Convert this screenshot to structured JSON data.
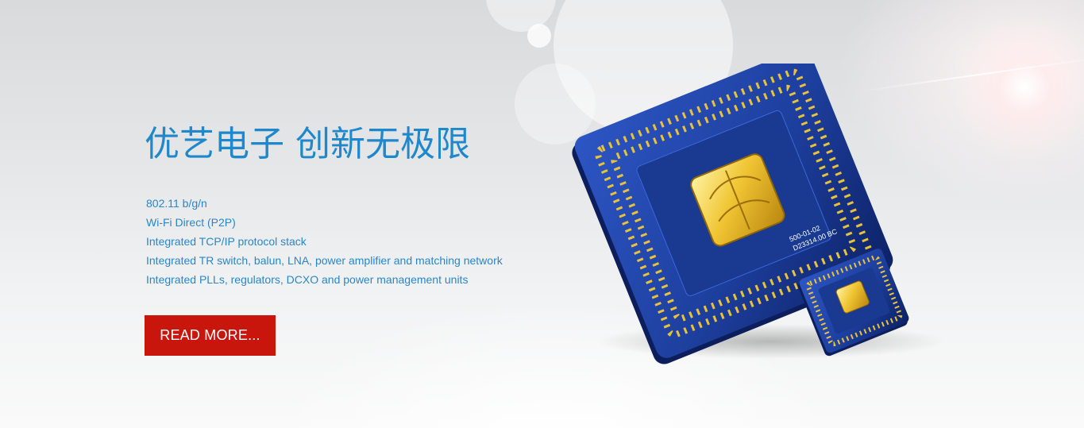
{
  "hero": {
    "headline": "优艺电子 创新无极限",
    "features": [
      "802.11 b/g/n",
      "Wi-Fi Direct (P2P)",
      "Integrated TCP/IP protocol stack",
      "Integrated TR switch, balun, LNA, power amplifier and matching network",
      "Integrated PLLs, regulators, DCXO and power management units"
    ],
    "cta_label": "READ MORE...",
    "chip_marking_line1": "500-01-02",
    "chip_marking_line2": "D23314.00 BC"
  },
  "colors": {
    "headline": "#1f88cc",
    "feature_text": "#2a86c9",
    "cta_background": "#c8160c",
    "chip_blue": "#1d3f9e",
    "chip_gold": "#e9c23b"
  },
  "icons": {
    "large_chip": "processor-chip-icon",
    "small_chip": "small-processor-chip-icon"
  }
}
